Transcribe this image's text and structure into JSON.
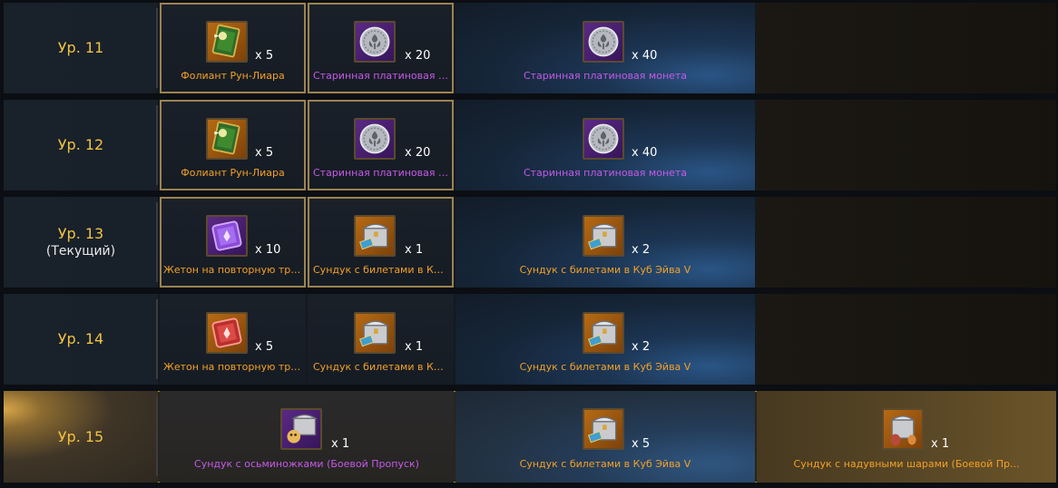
{
  "rows": [
    {
      "level": "Ур. 11",
      "current": "",
      "free1": {
        "qty": "x 5",
        "label": "Фолиант Рун-Лиара",
        "icon": "tome-icon"
      },
      "free2": {
        "qty": "x 20",
        "label": "Старинная платиновая моне...",
        "icon": "platinum-coin-icon"
      },
      "premium": {
        "qty": "x 40",
        "label": "Старинная платиновая монета",
        "icon": "platinum-coin-icon"
      },
      "extra": null
    },
    {
      "level": "Ур. 12",
      "current": "",
      "free1": {
        "qty": "x 5",
        "label": "Фолиант Рун-Лиара",
        "icon": "tome-icon"
      },
      "free2": {
        "qty": "x 20",
        "label": "Старинная платиновая мон...",
        "icon": "platinum-coin-icon"
      },
      "premium": {
        "qty": "x 40",
        "label": "Старинная платиновая монета",
        "icon": "platinum-coin-icon"
      },
      "extra": null
    },
    {
      "level": "Ур. 13",
      "current": "(Текущий)",
      "free1": {
        "qty": "x 10",
        "label": "Жетон на повторную транс...",
        "icon": "purple-token-icon"
      },
      "free2": {
        "qty": "x 1",
        "label": "Сундук с билетами в Куб Э...",
        "icon": "ticket-chest-icon"
      },
      "premium": {
        "qty": "x 2",
        "label": "Сундук с билетами в Куб Эйва V",
        "icon": "ticket-chest-icon"
      },
      "extra": null
    },
    {
      "level": "Ур. 14",
      "current": "",
      "free1": {
        "qty": "x 5",
        "label": "Жетон на повторную транс...",
        "icon": "red-token-icon"
      },
      "free2": {
        "qty": "x 1",
        "label": "Сундук с билетами в Куб Э...",
        "icon": "ticket-chest-icon"
      },
      "premium": {
        "qty": "x 2",
        "label": "Сундук с билетами в Куб Эйва V",
        "icon": "ticket-chest-icon"
      },
      "extra": null
    },
    {
      "level": "Ур. 15",
      "current": "",
      "free": {
        "qty": "x 1",
        "label": "Сундук с осьминожками (Боевой Пропуск)",
        "icon": "octopus-chest-icon"
      },
      "premium": {
        "qty": "x 5",
        "label": "Сундук с билетами в Куб Эйва V",
        "icon": "ticket-chest-icon"
      },
      "extra": {
        "qty": "x 1",
        "label": "Сундук с надувными шарами (Боевой Пр...",
        "icon": "balloon-chest-icon"
      }
    }
  ],
  "colors": {
    "level_text": "#f1c23f",
    "orange_label": "#f3a126",
    "purple_label": "#c65ae8"
  }
}
